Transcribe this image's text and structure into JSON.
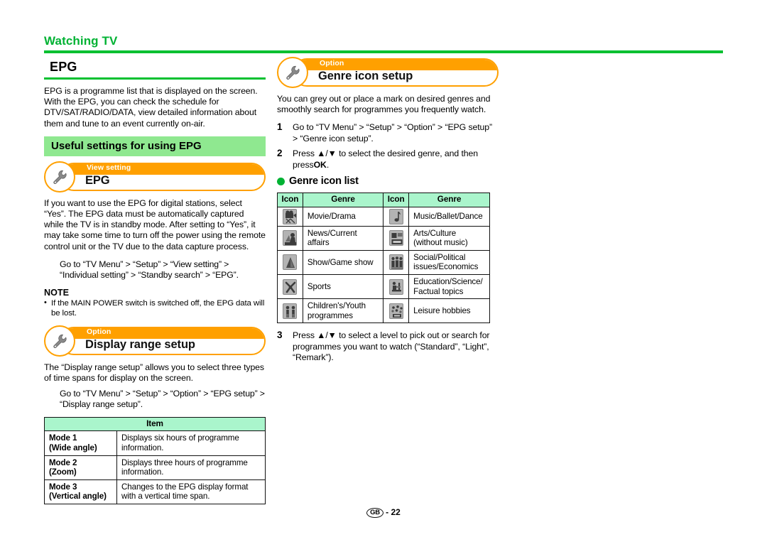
{
  "running_head": {
    "part_a": "Watching",
    "part_b": "TV"
  },
  "colors": {
    "green_accent": "#00c030",
    "green_banner": "#8fe890",
    "orange": "#ffa000",
    "table_header_green": "#aaf5cc",
    "icon_grey": "#b3b3b3"
  },
  "left_column": {
    "chapter_title": "EPG",
    "intro_paragraph": "EPG is a programme list that is displayed on the screen. With the EPG, you can check the schedule for DTV/SAT/RADIO/DATA, view detailed information about them and tune to an event currently on-air.",
    "section_banner": "Useful settings for using EPG",
    "epg_panel": {
      "kicker": "View setting",
      "title": "EPG",
      "icon": "wrench-icon",
      "paragraph": "If you want to use the EPG for digital stations, select “Yes”. The EPG data must be automatically captured while the TV is in standby mode. After setting to “Yes”, it may take some time to turn off the power using the remote control unit or the TV due to the data capture process.",
      "goto": "Go to “TV Menu” > “Setup” > “View setting” > “Individual setting” > “Standby search” > “EPG”.",
      "note_title": "NOTE",
      "note_items": [
        "If the MAIN POWER switch is switched off, the EPG data will be lost."
      ]
    },
    "display_range_panel": {
      "kicker": "Option",
      "title": "Display range setup",
      "icon": "wrench-icon",
      "paragraph": "The “Display range setup” allows you to select three types of time spans for display on the screen.",
      "goto": "Go to “TV Menu” > “Setup” > “Option” > “EPG setup” > “Display range setup”.",
      "table": {
        "header": "Item",
        "rows": [
          {
            "mode": "Mode 1\n(Wide angle)",
            "mode_line1": "Mode 1",
            "mode_line2": "(Wide angle)",
            "description": "Displays six hours of programme information."
          },
          {
            "mode": "Mode 2\n(Zoom)",
            "mode_line1": "Mode 2",
            "mode_line2": "(Zoom)",
            "description": "Displays three hours of programme information."
          },
          {
            "mode": "Mode 3\n(Vertical angle)",
            "mode_line1": "Mode 3",
            "mode_line2": "(Vertical angle)",
            "description": "Changes to the EPG display format with a vertical time span."
          }
        ]
      }
    }
  },
  "right_column": {
    "genre_panel": {
      "kicker": "Option",
      "title": "Genre icon setup",
      "icon": "wrench-icon",
      "paragraph": "You can grey out or place a mark on desired genres and smoothly search for programmes you frequently watch.",
      "steps": [
        {
          "num": "1",
          "text_before": "Go to “TV Menu” > “Setup” > “Option” > “EPG setup” > “Genre icon setup”."
        },
        {
          "num": "2",
          "lead": "Press",
          "arrows": "▲/▼",
          "mid": "to select the desired genre, and then press",
          "bold": "OK",
          "tail": "."
        },
        {
          "num": "3",
          "lead": "Press",
          "arrows": "▲/▼",
          "mid": "to select a level to pick out or search for programmes you want to watch (“Standard”, “Light”, “Remark”).",
          "bold": "",
          "tail": ""
        }
      ],
      "list_heading": "Genre icon list",
      "table": {
        "headers": [
          "Icon",
          "Genre",
          "Icon",
          "Genre"
        ],
        "rows": [
          {
            "icon_left": "movie-drama-icon",
            "genre_left": "Movie/Drama",
            "icon_right": "music-ballet-dance-icon",
            "genre_right": "Music/Ballet/Dance"
          },
          {
            "icon_left": "news-current-affairs-icon",
            "genre_left": "News/Current affairs",
            "icon_right": "arts-culture-icon",
            "genre_right": "Arts/Culture (without music)"
          },
          {
            "icon_left": "show-game-show-icon",
            "genre_left": "Show/Game show",
            "icon_right": "social-political-icon",
            "genre_right": "Social/Political issues/Economics"
          },
          {
            "icon_left": "sports-icon",
            "genre_left": "Sports",
            "icon_right": "education-science-icon",
            "genre_right": "Education/Science/ Factual topics"
          },
          {
            "icon_left": "children-youth-icon",
            "genre_left": "Children's/Youth programmes",
            "icon_right": "leisure-hobbies-icon",
            "genre_right": "Leisure hobbies"
          }
        ]
      }
    }
  },
  "footer": {
    "region": "GB",
    "separator": "-",
    "page_number": "22"
  }
}
